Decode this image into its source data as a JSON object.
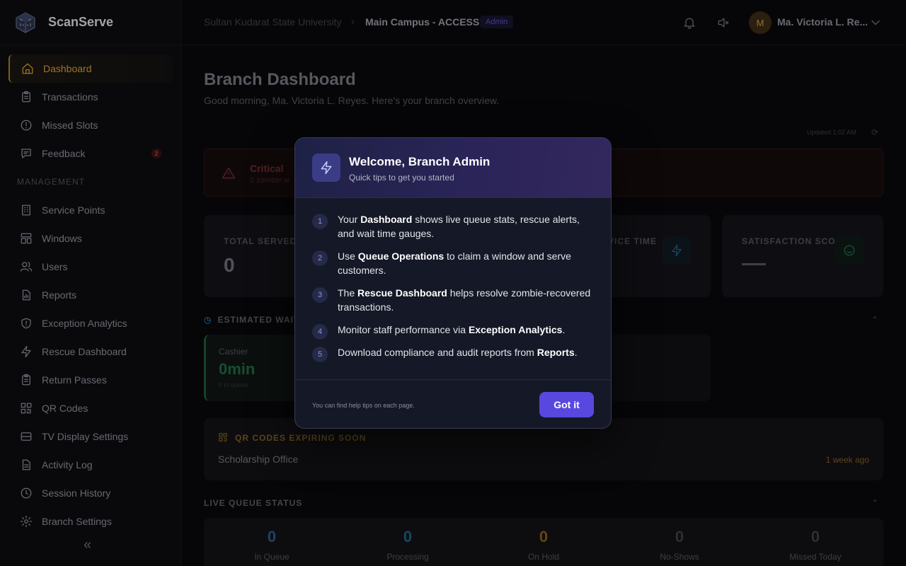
{
  "app": {
    "name": "ScanServe"
  },
  "sidebar": {
    "items": [
      {
        "label": "Dashboard",
        "icon": "home-icon"
      },
      {
        "label": "Transactions",
        "icon": "clipboard-icon"
      },
      {
        "label": "Missed Slots",
        "icon": "alert-circle-icon"
      },
      {
        "label": "Feedback",
        "icon": "message-icon",
        "badge": "2"
      }
    ],
    "management_label": "MANAGEMENT",
    "management_items": [
      {
        "label": "Service Points",
        "icon": "building-icon"
      },
      {
        "label": "Windows",
        "icon": "layout-icon"
      },
      {
        "label": "Users",
        "icon": "users-icon"
      },
      {
        "label": "Reports",
        "icon": "report-icon"
      },
      {
        "label": "Exception Analytics",
        "icon": "shield-icon"
      },
      {
        "label": "Rescue Dashboard",
        "icon": "bolt-icon"
      },
      {
        "label": "Return Passes",
        "icon": "clipboard-icon"
      },
      {
        "label": "QR Codes",
        "icon": "qr-icon"
      },
      {
        "label": "TV Display Settings",
        "icon": "tv-icon"
      },
      {
        "label": "Activity Log",
        "icon": "document-icon"
      },
      {
        "label": "Session History",
        "icon": "clock-icon"
      },
      {
        "label": "Branch Settings",
        "icon": "gear-icon"
      }
    ]
  },
  "header": {
    "org": "Sultan Kudarat State University",
    "current": "Main Campus - ACCESS",
    "role": "Admin",
    "avatar_initial": "M",
    "user_name": "Ma. Victoria L. Re..."
  },
  "page": {
    "title": "Branch Dashboard",
    "subtitle": "Good morning, Ma. Victoria L. Reyes. Here's your branch overview.",
    "updated": "Updated 1:02 AM",
    "alert_title": "Critical",
    "alert_desc": "2 zombie w",
    "stats": [
      {
        "label": "TOTAL SERVED T",
        "value": "0"
      },
      {
        "label": "VICE TIME",
        "value": ""
      },
      {
        "label": "SATISFACTION SCO...",
        "value": ""
      }
    ],
    "wait_section": "ESTIMATED WAIT",
    "cashier": {
      "name": "Cashier",
      "value": "0min",
      "sub": "0 in queue"
    },
    "qr": {
      "heading": "QR CODES EXPIRING SOON",
      "item": "Scholarship Office",
      "time": "1 week ago"
    },
    "live_section": "LIVE QUEUE STATUS",
    "live": [
      {
        "value": "0",
        "label": "In Queue",
        "color": "#2a5a8c"
      },
      {
        "value": "0",
        "label": "Processing",
        "color": "#1f5f86"
      },
      {
        "value": "0",
        "label": "On Hold",
        "color": "#8a5a16"
      },
      {
        "value": "0",
        "label": "No-Shows",
        "color": "#3e3f48"
      },
      {
        "value": "0",
        "label": "Missed Today",
        "color": "#3e3f48"
      }
    ]
  },
  "modal": {
    "title": "Welcome, Branch Admin",
    "subtitle": "Quick tips to get you started",
    "tips": [
      {
        "num": "1",
        "pre": "Your ",
        "bold": "Dashboard",
        "post": " shows live queue stats, rescue alerts, and wait time gauges."
      },
      {
        "num": "2",
        "pre": "Use ",
        "bold": "Queue Operations",
        "post": " to claim a window and serve customers."
      },
      {
        "num": "3",
        "pre": "The ",
        "bold": "Rescue Dashboard",
        "post": " helps resolve zombie-recovered transactions."
      },
      {
        "num": "4",
        "pre": "Monitor staff performance via ",
        "bold": "Exception Analytics",
        "post": "."
      },
      {
        "num": "5",
        "pre": "Download compliance and audit reports from ",
        "bold": "Reports",
        "post": "."
      }
    ],
    "footer_note": "You can find help tips on each page.",
    "button": "Got it"
  },
  "colors": {
    "accent": "#5848e0",
    "active_nav": "#d69a34"
  }
}
